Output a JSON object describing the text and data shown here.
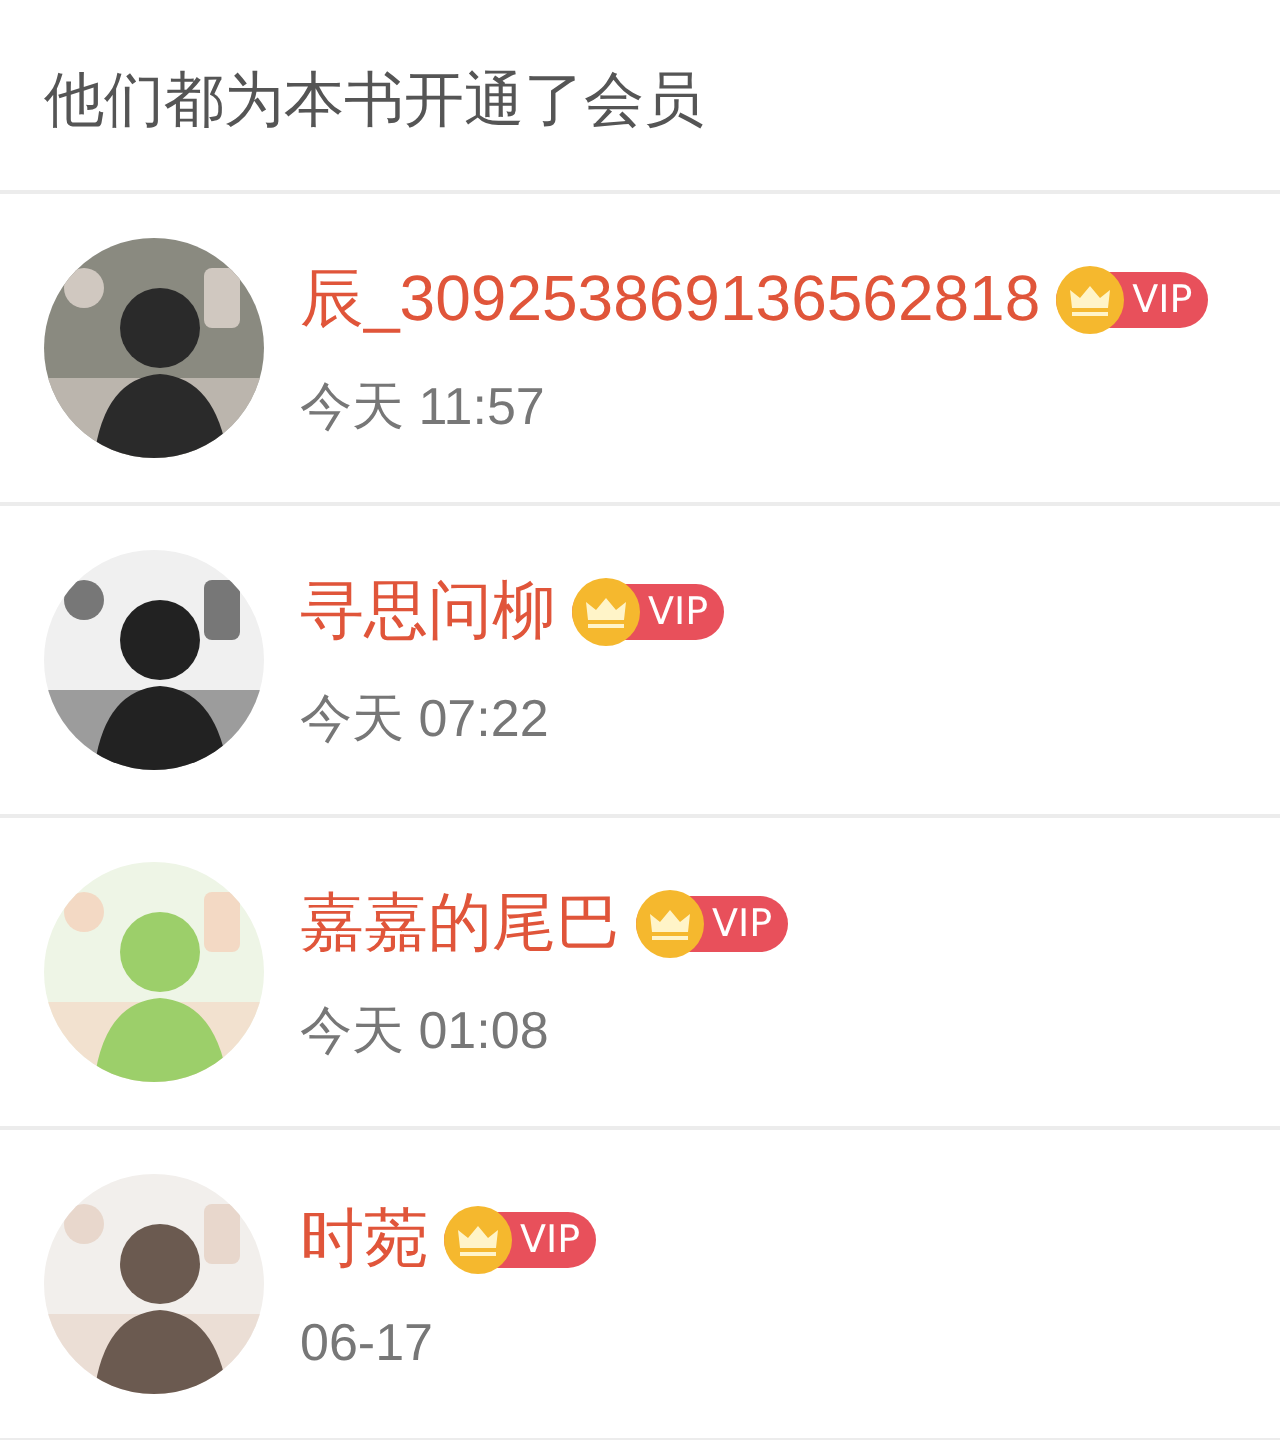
{
  "header": {
    "title": "他们都为本书开通了会员"
  },
  "members": [
    {
      "name": "辰_309253869136562818",
      "vip": true,
      "badge": "VIP",
      "time": "今天 11:57"
    },
    {
      "name": "寻思问柳",
      "vip": true,
      "badge": "VIP",
      "time": "今天 07:22"
    },
    {
      "name": "嘉嘉的尾巴",
      "vip": true,
      "badge": "VIP",
      "time": "今天 01:08"
    },
    {
      "name": "时菀",
      "vip": true,
      "badge": "VIP",
      "time": "06-17"
    }
  ]
}
